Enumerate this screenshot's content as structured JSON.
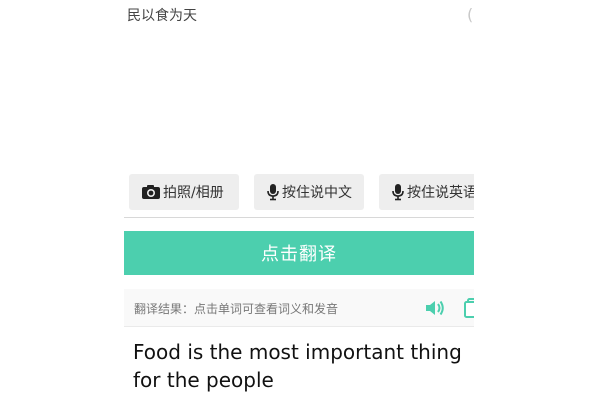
{
  "input": {
    "source_text": "民以食为天",
    "clear_glyph": "("
  },
  "actions": {
    "photo_label": "拍照/相册",
    "speak_chinese_label": "按住说中文",
    "speak_english_label": "按住说英语"
  },
  "translate_button": {
    "label": "点击翻译",
    "color": "#4ccfae"
  },
  "result": {
    "header_label": "翻译结果：点击单词可查看词义和发音",
    "text": "Food is the most important thing for the people",
    "speaker_icon": "speaker-icon",
    "copy_icon": "copy-icon",
    "speaker_color": "#4ccfae"
  }
}
